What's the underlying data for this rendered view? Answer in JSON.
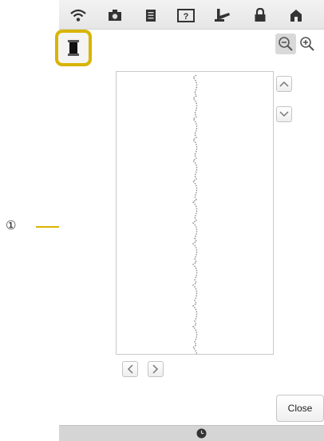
{
  "topbar": {
    "icons": [
      "wifi-icon",
      "camera-icon",
      "document-icon",
      "help-icon",
      "presser-foot-icon",
      "lock-icon",
      "home-icon"
    ]
  },
  "callout": {
    "number": "①"
  },
  "buttons": {
    "close_label": "Close"
  },
  "colors": {
    "accent": "#d8b400",
    "topbar": "#eaeaea",
    "stitch": "#8a8a8a"
  }
}
